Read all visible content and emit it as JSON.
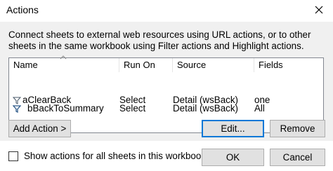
{
  "window": {
    "title": "Actions"
  },
  "description": "Connect sheets to external web resources using URL actions, or to other sheets in the same workbook using Filter actions and Highlight actions.",
  "list": {
    "columns": [
      "Name",
      "Run On",
      "Source",
      "Fields"
    ],
    "rows": [
      {
        "icon": "filter-icon",
        "name": "aClearBack",
        "run_on": "Select",
        "source": "Detail (wsBack)",
        "fields": "one"
      },
      {
        "icon": "filter-icon",
        "name": "bBackToSummary",
        "run_on": "Select",
        "source": "Detail (wsBack)",
        "fields": "All"
      }
    ]
  },
  "buttons": {
    "add_action": "Add Action >",
    "edit": "Edit...",
    "remove": "Remove",
    "ok": "OK",
    "cancel": "Cancel"
  },
  "footer": {
    "show_all_label": "Show actions for all sheets in this workbook",
    "show_all_checked": false
  },
  "colors": {
    "accent": "#0078d7",
    "panel": "#f0f0f0",
    "button": "#e1e1e1"
  }
}
